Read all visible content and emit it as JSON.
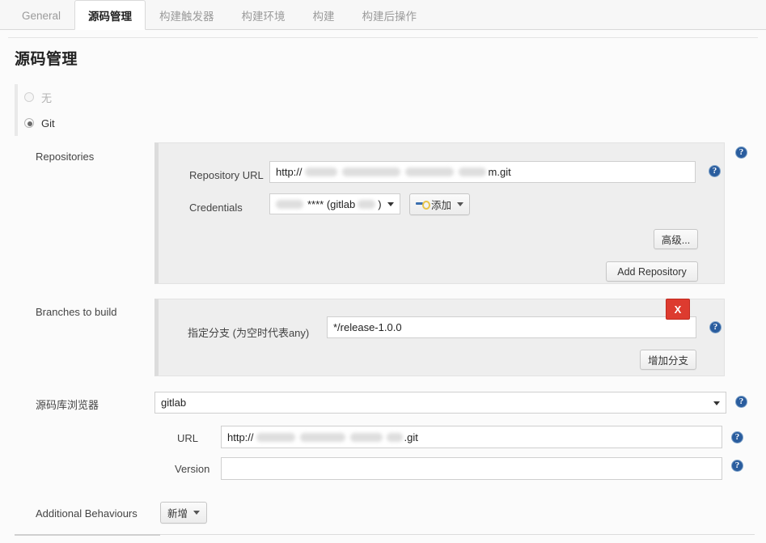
{
  "tabs": [
    {
      "label": "General",
      "active": false
    },
    {
      "label": "源码管理",
      "active": true
    },
    {
      "label": "构建触发器",
      "active": false
    },
    {
      "label": "构建环境",
      "active": false
    },
    {
      "label": "构建",
      "active": false
    },
    {
      "label": "构建后操作",
      "active": false
    }
  ],
  "page": {
    "title": "源码管理"
  },
  "scm_options": [
    {
      "label": "无",
      "selected": false
    },
    {
      "label": "Git",
      "selected": true
    }
  ],
  "repositories": {
    "section_label": "Repositories",
    "repository_url": {
      "label": "Repository URL",
      "value_prefix": "http://",
      "value_suffix": "m.git",
      "redacted": true
    },
    "credentials": {
      "label": "Credentials",
      "value_middle": "**** (gitlab",
      "value_end": ")",
      "redacted": true
    },
    "add_credentials_button": "添加",
    "advanced_button": "高级...",
    "add_repository_button": "Add Repository"
  },
  "branches": {
    "section_label": "Branches to build",
    "branch_specifier": {
      "label": "指定分支 (为空时代表any)",
      "value": "*/release-1.0.0"
    },
    "delete_button": "X",
    "add_branch_button": "增加分支"
  },
  "repository_browser": {
    "label": "源码库浏览器",
    "selected": "gitlab",
    "url": {
      "label": "URL",
      "value_prefix": "http://",
      "value_suffix": ".git",
      "redacted": true
    },
    "version": {
      "label": "Version",
      "value": ""
    }
  },
  "additional_behaviours": {
    "label": "Additional Behaviours",
    "add_button": "新增"
  },
  "colors": {
    "accent_help": "#2a5d9e",
    "danger": "#dd3b2f",
    "panel": "#eeeeee",
    "page_bg": "#fbfbfb"
  }
}
